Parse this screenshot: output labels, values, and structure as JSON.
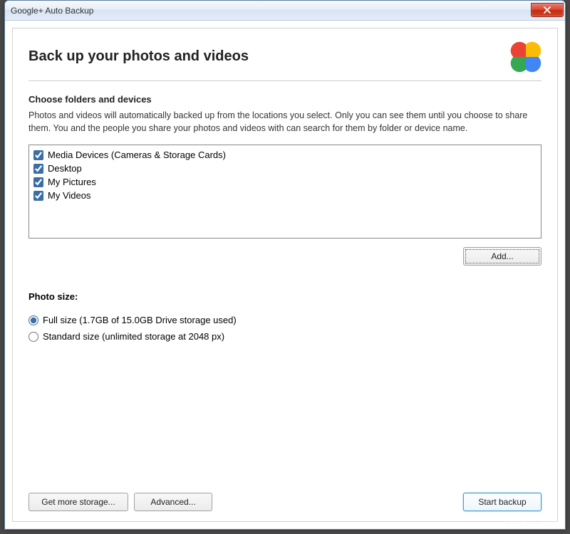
{
  "window": {
    "title": "Google+ Auto Backup"
  },
  "header": {
    "heading": "Back up your photos and videos"
  },
  "section1": {
    "heading": "Choose folders and devices",
    "description": "Photos and videos will automatically backed up from the locations you select.  Only you can see them until you choose to share them.  You and the people you share your photos and videos with can search for them by folder or device name."
  },
  "folders": [
    {
      "label": "Media Devices (Cameras & Storage Cards)",
      "checked": true
    },
    {
      "label": "Desktop",
      "checked": true
    },
    {
      "label": "My Pictures",
      "checked": true
    },
    {
      "label": "My Videos",
      "checked": true
    }
  ],
  "buttons": {
    "add": "Add...",
    "get_more_storage": "Get more storage...",
    "advanced": "Advanced...",
    "start_backup": "Start backup"
  },
  "photo_size": {
    "heading": "Photo size:",
    "options": [
      {
        "label": "Full size (1.7GB of 15.0GB Drive storage used)",
        "selected": true
      },
      {
        "label": "Standard size (unlimited storage at 2048 px)",
        "selected": false
      }
    ]
  },
  "watermark": "LO4D.com",
  "logo_colors": {
    "yellow": "#fbbc05",
    "red": "#ea4335",
    "blue": "#4285f4",
    "green": "#34a853"
  }
}
